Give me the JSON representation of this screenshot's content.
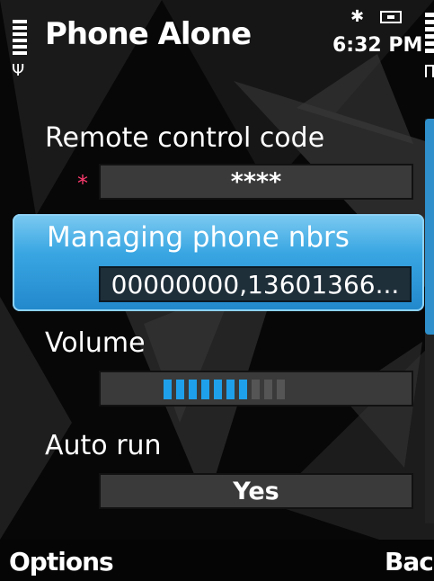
{
  "status": {
    "title": "Phone Alone",
    "bluetooth_icon": "bluetooth-icon",
    "memory_icon": "memory-card-icon",
    "time": "6:32 PM"
  },
  "settings": [
    {
      "label": "Remote control code",
      "value": "****",
      "required_marker": "*"
    },
    {
      "label": "Managing phone nbrs",
      "value": "00000000,13601366...",
      "selected": true
    },
    {
      "label": "Volume",
      "level": 7,
      "max": 10
    },
    {
      "label": "Auto run",
      "value": "Yes"
    }
  ],
  "softkeys": {
    "left": "Options",
    "right": "Back"
  },
  "colors": {
    "highlight": "#2a90d4",
    "volume_active": "#1fa0ea",
    "volume_inactive": "#555555",
    "required": "#ff3b70"
  }
}
